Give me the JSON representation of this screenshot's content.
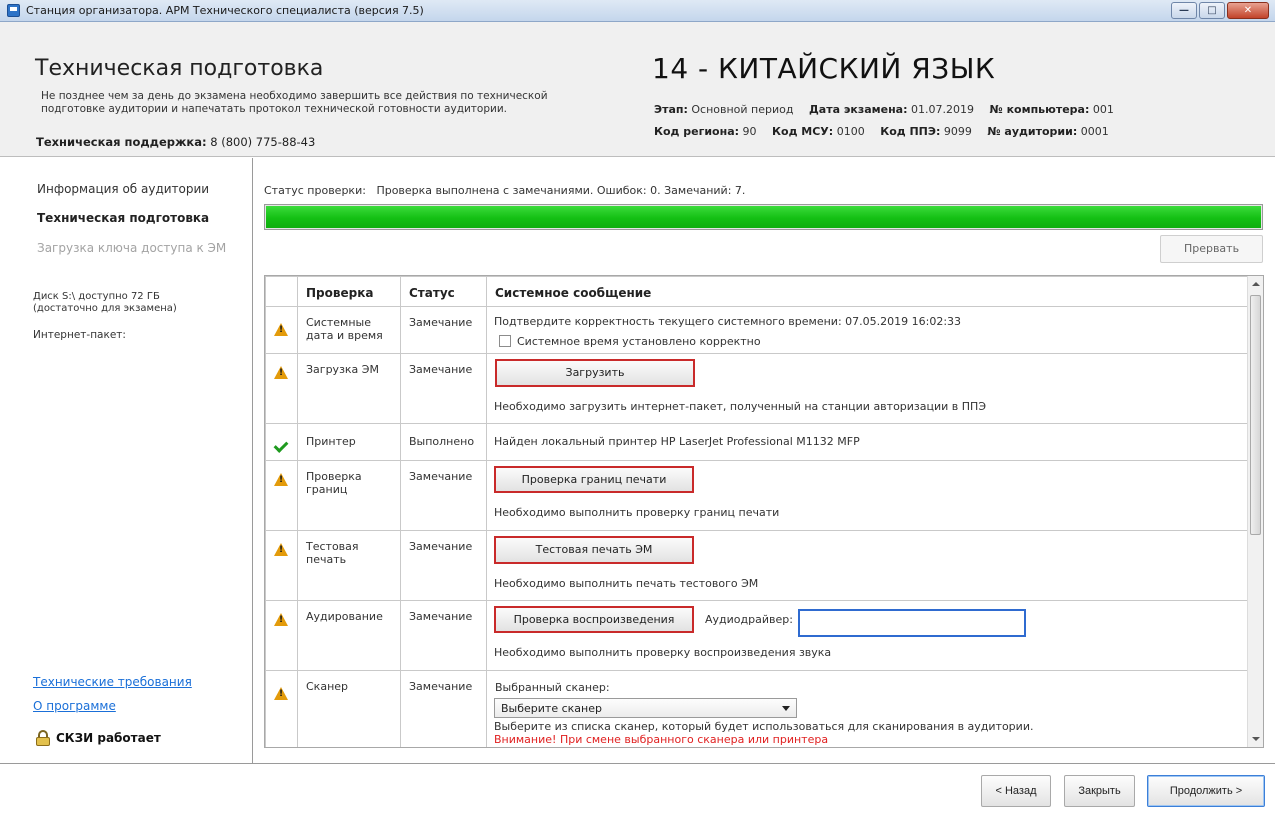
{
  "window": {
    "title": "Станция организатора. АРМ Технического специалиста (версия 7.5)",
    "minimize_glyph": "—",
    "maximize_glyph": "□",
    "close_glyph": "✕"
  },
  "header": {
    "title": "Техническая подготовка",
    "note_line1": "Не позднее чем за день до экзамена необходимо завершить все действия по технической",
    "note_line2": "подготовке аудитории и напечатать протокол технической готовности аудитории.",
    "support_label": "Техническая поддержка:",
    "support_phone": "8 (800) 775-88-43",
    "subject": "14 - КИТАЙСКИЙ ЯЗЫК",
    "stage_label": "Этап:",
    "stage_value": "Основной период",
    "exam_date_label": "Дата экзамена:",
    "exam_date_value": "01.07.2019",
    "computer_label": "№ компьютера:",
    "computer_value": "001",
    "region_label": "Код региона:",
    "region_value": "90",
    "msu_label": "Код МСУ:",
    "msu_value": "0100",
    "ppe_label": "Код ППЭ:",
    "ppe_value": "9099",
    "room_label": "№ аудитории:",
    "room_value": "0001"
  },
  "sidebar": {
    "items": [
      {
        "label": "Информация об аудитории",
        "state": "done"
      },
      {
        "label": "Техническая подготовка",
        "state": "active"
      },
      {
        "label": "Загрузка ключа доступа к ЭМ",
        "state": "disabled"
      }
    ],
    "disk_line1": "Диск S:\\ доступно 72 ГБ",
    "disk_line2": "(достаточно для экзамена)",
    "internet_package": "Интернет-пакет:",
    "link_requirements": "Технические требования",
    "link_about": "О программе",
    "skzi_status": "СКЗИ работает"
  },
  "main": {
    "status_label": "Статус проверки:",
    "status_text": "Проверка выполнена с замечаниями. Ошибок: 0. Замечаний: 7.",
    "progress_percent": 100,
    "stop_button": "Прервать",
    "columns": [
      "Проверка",
      "Статус",
      "Системное сообщение"
    ],
    "rows": [
      {
        "icon": "warning-icon",
        "check": "Системные дата и время",
        "status": "Замечание",
        "message": "Подтвердите корректность текущего системного времени: 07.05.2019 16:02:33",
        "checkbox_label": "Системное время установлено корректно"
      },
      {
        "icon": "warning-icon",
        "check": "Загрузка ЭМ",
        "status": "Замечание",
        "button": "Загрузить",
        "message": "Необходимо загрузить интернет-пакет, полученный на станции авторизации в ППЭ"
      },
      {
        "icon": "check-icon",
        "check": "Принтер",
        "status": "Выполнено",
        "message": "Найден локальный принтер HP LaserJet Professional M1132 MFP"
      },
      {
        "icon": "warning-icon",
        "check": "Проверка границ",
        "status": "Замечание",
        "button": "Проверка границ печати",
        "message": "Необходимо выполнить проверку границ печати"
      },
      {
        "icon": "warning-icon",
        "check": "Тестовая печать",
        "status": "Замечание",
        "button": "Тестовая печать ЭМ",
        "message": "Необходимо выполнить печать тестового ЭМ"
      },
      {
        "icon": "warning-icon",
        "check": "Аудирование",
        "status": "Замечание",
        "button": "Проверка воспроизведения",
        "audio_label": "Аудиодрайвер:",
        "audio_value": "",
        "message": "Необходимо выполнить проверку воспроизведения звука"
      },
      {
        "icon": "warning-icon",
        "check": "Сканер",
        "status": "Замечание",
        "scanner_label": "Выбранный сканер:",
        "scanner_select": "Выберите сканер",
        "message": "Выберите из списка сканер, который будет использоваться для сканирования в аудитории.",
        "warning_text": "Внимание! При смене выбранного сканера или принтера"
      }
    ]
  },
  "footer": {
    "back": "< Назад",
    "close": "Закрыть",
    "continue": "Продолжить >"
  },
  "colors": {
    "progress": "#14c014",
    "warning": "#e39b0b",
    "ok": "#1f9a1f",
    "link": "#1a6fd8",
    "highlight_border": "#c92a2a"
  }
}
